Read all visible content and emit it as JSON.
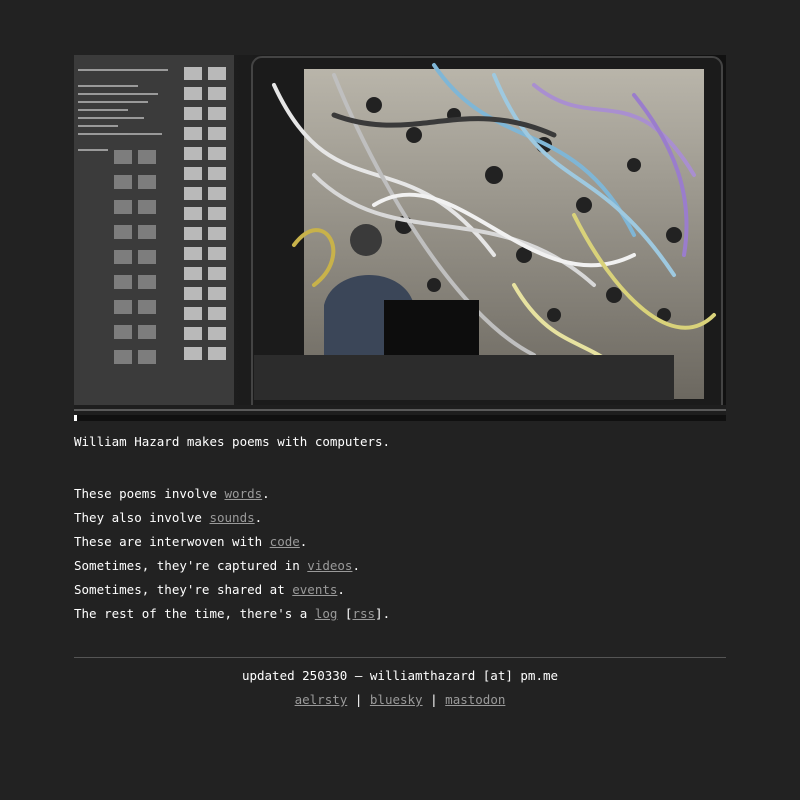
{
  "intro": "William Hazard makes poems with computers.",
  "lines": [
    {
      "pre": "These poems involve ",
      "link": "words",
      "post": "."
    },
    {
      "pre": "They also involve ",
      "link": "sounds",
      "post": "."
    },
    {
      "pre": "These are interwoven with ",
      "link": "code",
      "post": "."
    },
    {
      "pre": "Sometimes, they're captured in ",
      "link": "videos",
      "post": "."
    },
    {
      "pre": "Sometimes, they're shared at ",
      "link": "events",
      "post": "."
    },
    {
      "pre": "The rest of the time, there's a ",
      "link": "log",
      "mid": " [",
      "link2": "rss",
      "post": "]."
    }
  ],
  "footer": {
    "updated": "updated 250330 — williamthazard [at] pm.me",
    "social": [
      "aelrsty",
      "bluesky",
      "mastodon"
    ],
    "separator": "|"
  },
  "colors": {
    "background": "#222222",
    "text": "#ffffff",
    "link": "#9a9a9a",
    "rule": "#555555"
  }
}
